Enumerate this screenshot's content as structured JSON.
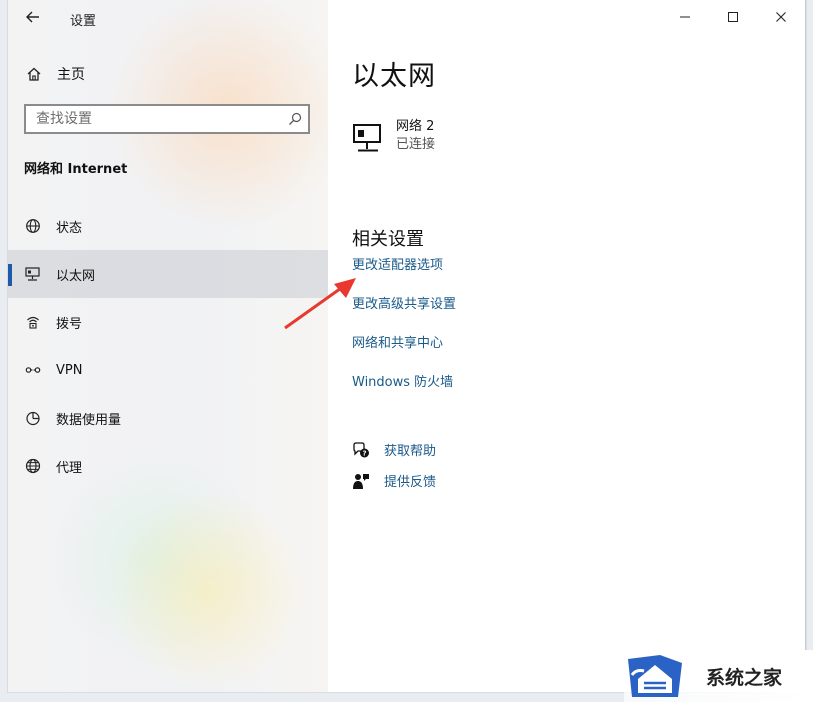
{
  "titlebar": {
    "app_title": "设置"
  },
  "sidebar": {
    "home_label": "主页",
    "search_placeholder": "查找设置",
    "section_title": "网络和 Internet",
    "items": [
      {
        "label": "状态",
        "icon": "globe-status-icon"
      },
      {
        "label": "以太网",
        "icon": "ethernet-icon",
        "selected": true
      },
      {
        "label": "拨号",
        "icon": "dialup-icon"
      },
      {
        "label": "VPN",
        "icon": "vpn-icon"
      },
      {
        "label": "数据使用量",
        "icon": "data-usage-icon"
      },
      {
        "label": "代理",
        "icon": "globe-icon"
      }
    ]
  },
  "main": {
    "page_title": "以太网",
    "network": {
      "name": "网络 2",
      "status": "已连接"
    },
    "related_title": "相关设置",
    "links": [
      "更改适配器选项",
      "更改高级共享设置",
      "网络和共享中心",
      "Windows 防火墙"
    ],
    "help": [
      {
        "label": "获取帮助",
        "icon": "help-chat-icon"
      },
      {
        "label": "提供反馈",
        "icon": "feedback-icon"
      }
    ]
  },
  "watermark": {
    "text": "系统之家"
  },
  "colors": {
    "accent": "#1e5aa8",
    "link": "#1a5a8a",
    "annotation_arrow": "#e8382f"
  }
}
